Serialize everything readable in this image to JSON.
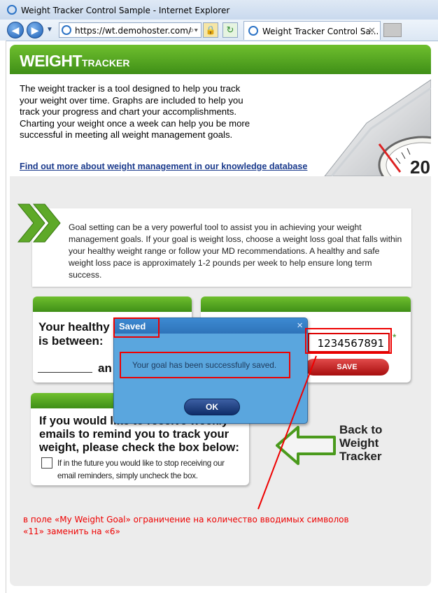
{
  "browser": {
    "window_title": "Weight Tracker Control Sample - Internet Explorer",
    "url": "https://wt.demohoster.com/",
    "tab_label": "Weight Tracker Control Sa..."
  },
  "header": {
    "logo_main": "WEIGHT",
    "logo_sub": "TRACKER"
  },
  "intro": {
    "text": "The weight tracker is a tool designed to help you track your weight over time. Graphs are included to help you track your progress and chart your accomplishments. Charting your weight once a week can help you be more successful in meeting all weight management goals.",
    "link": "Find out more about weight management in our knowledge database",
    "scale_number": "20"
  },
  "goal_info": {
    "text": "Goal setting can be a very powerful tool to assist you in achieving your weight management goals.  If your goal is weight loss, choose a weight loss goal that falls within your healthy weight range or follow your MD recommendations.  A healthy and safe weight loss pace is approximately 1-2 pounds per week to help ensure long term success."
  },
  "healthy_panel": {
    "line1": "Your healthy",
    "line2": "is between:",
    "and_label": "an"
  },
  "goal_panel": {
    "input_value": "1234567891",
    "required_mark": "*",
    "save_label": "SAVE"
  },
  "email_panel": {
    "text": "If you would like to receive weekly emails to remind you to track your weight, please check the box below:",
    "checkbox_label": "If in the future you would like to stop receiving our email reminders, simply uncheck the box."
  },
  "back_link": {
    "line1": "Back to",
    "line2": "Weight",
    "line3": "Tracker"
  },
  "dialog": {
    "title": "Saved",
    "close": "×",
    "message": "Your goal has been successfully saved.",
    "ok_label": "OK"
  },
  "annotation": {
    "text": "в поле «My Weight Goal» ограничение на количество вводимых символов «11» заменить на «6»",
    "color": "#ee0000"
  },
  "colors": {
    "accent_green": "#4fa21f",
    "dialog_blue": "#5aa6de",
    "save_red": "#c41e1e"
  }
}
